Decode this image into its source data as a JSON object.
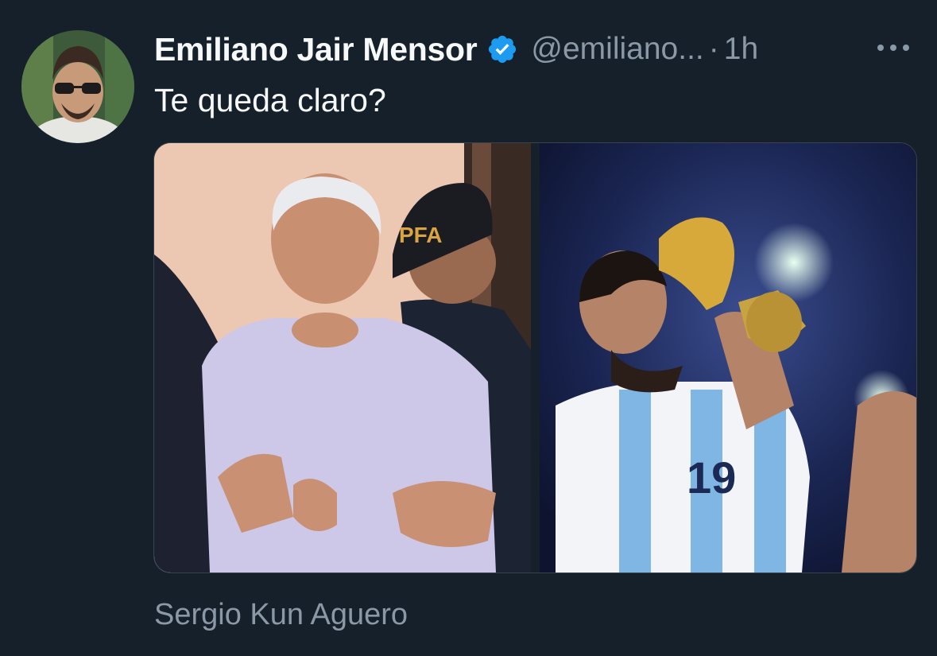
{
  "tweet": {
    "author": {
      "display_name": "Emiliano Jair Mensor",
      "handle": "@emiliano...",
      "verified": true,
      "verified_icon": "verified-badge-icon",
      "avatar_icon": "user-avatar"
    },
    "separator": "·",
    "time": "1h",
    "more_icon": "more-options-icon",
    "text": "Te queda claro?",
    "media": [
      {
        "name": "photo-arrest",
        "badge_text": "PFA"
      },
      {
        "name": "photo-world-cup",
        "jersey_number": "19"
      }
    ],
    "footer": "Sergio Kun Aguero"
  },
  "colors": {
    "background": "#15202b",
    "primary_text": "#f7f9f9",
    "secondary_text": "#8b98a5",
    "verified_blue": "#1d9bf0",
    "border": "#38444d"
  }
}
